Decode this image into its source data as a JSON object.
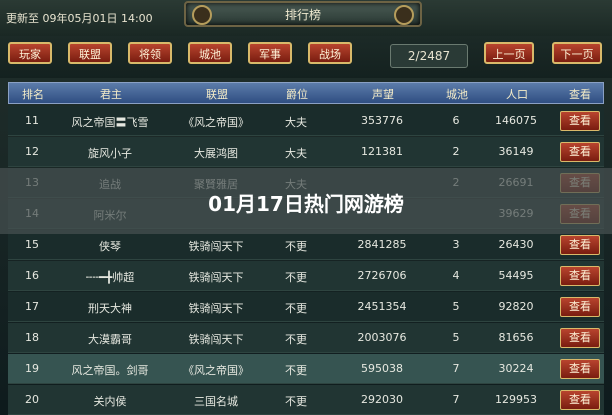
{
  "header": {
    "update_text": "更新至 09年05月01日 14:00",
    "banner_title": "排行榜"
  },
  "toolbar": {
    "tabs": [
      "玩家",
      "联盟",
      "将领",
      "城池",
      "军事",
      "战场"
    ],
    "page_indicator": "2/2487",
    "prev_label": "上一页",
    "next_label": "下一页"
  },
  "table": {
    "columns": [
      "排名",
      "君主",
      "联盟",
      "爵位",
      "声望",
      "城池",
      "人口",
      "查看"
    ],
    "view_label": "查看",
    "rows": [
      [
        "11",
        "风之帝国〓飞雪",
        "《风之帝国》",
        "大夫",
        "353776",
        "6",
        "146075"
      ],
      [
        "12",
        "旋风小子",
        "大展鸿图",
        "大夫",
        "121381",
        "2",
        "36149"
      ],
      [
        "13",
        "追战",
        "聚賢雅居",
        "大夫",
        "",
        "2",
        "26691"
      ],
      [
        "14",
        "阿米尔",
        "",
        "",
        "",
        "",
        "39629"
      ],
      [
        "15",
        "侠琴",
        "铁骑闯天下",
        "不更",
        "2841285",
        "3",
        "26430"
      ],
      [
        "16",
        "╌╌━╋帅超",
        "铁骑闯天下",
        "不更",
        "2726706",
        "4",
        "54495"
      ],
      [
        "17",
        "刑天大神",
        "铁骑闯天下",
        "不更",
        "2451354",
        "5",
        "92820"
      ],
      [
        "18",
        "大漠霸哥",
        "铁骑闯天下",
        "不更",
        "2003076",
        "5",
        "81656"
      ],
      [
        "19",
        "风之帝国。剑哥",
        "《风之帝国》",
        "不更",
        "595038",
        "7",
        "30224"
      ],
      [
        "20",
        "关内侯",
        "三国名城",
        "不更",
        "292030",
        "7",
        "129953"
      ]
    ]
  },
  "overlay": {
    "title": "01月17日热门网游榜"
  },
  "colors": {
    "button_red": "#9a2c1c",
    "header_blue": "#3f5f92",
    "gold_border": "#d9b96a"
  }
}
